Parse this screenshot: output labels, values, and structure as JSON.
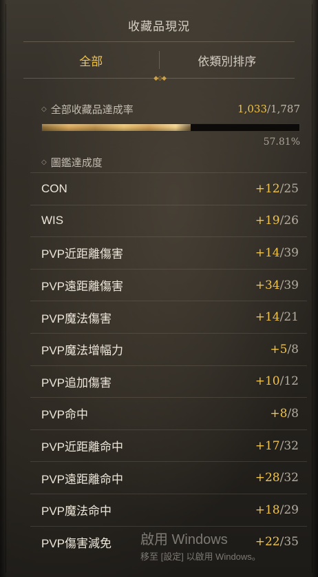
{
  "header": {
    "title": "收藏品現況"
  },
  "tabs": [
    {
      "label": "全部",
      "active": true
    },
    {
      "label": "依類別排序",
      "active": false
    }
  ],
  "overall": {
    "label": "全部收藏品達成率",
    "current": "1,033",
    "total": "/1,787",
    "percent": "57.81%",
    "progress": 0.5781
  },
  "codex": {
    "label": "圖鑑達成度"
  },
  "items": [
    {
      "name": "CON",
      "current": "+12",
      "max": "25"
    },
    {
      "name": "WIS",
      "current": "+19",
      "max": "26"
    },
    {
      "name": "PVP近距離傷害",
      "current": "+14",
      "max": "39"
    },
    {
      "name": "PVP遠距離傷害",
      "current": "+34",
      "max": "39"
    },
    {
      "name": "PVP魔法傷害",
      "current": "+14",
      "max": "21"
    },
    {
      "name": "PVP魔法增幅力",
      "current": "+5",
      "max": "8"
    },
    {
      "name": "PVP追加傷害",
      "current": "+10",
      "max": "12"
    },
    {
      "name": "PVP命中",
      "current": "+8",
      "max": "8"
    },
    {
      "name": "PVP近距離命中",
      "current": "+17",
      "max": "32"
    },
    {
      "name": "PVP遠距離命中",
      "current": "+28",
      "max": "32"
    },
    {
      "name": "PVP魔法命中",
      "current": "+18",
      "max": "29"
    },
    {
      "name": "PVP傷害減免",
      "current": "+22",
      "max": "35"
    }
  ],
  "watermark": {
    "title": "啟用 Windows",
    "subtitle": "移至 [設定] 以啟用 Windows。"
  },
  "colors": {
    "accent": "#f0c34a",
    "text": "#ece6da",
    "muted": "#b3ac9f"
  },
  "icons": {
    "bullet": "diamond-icon"
  }
}
